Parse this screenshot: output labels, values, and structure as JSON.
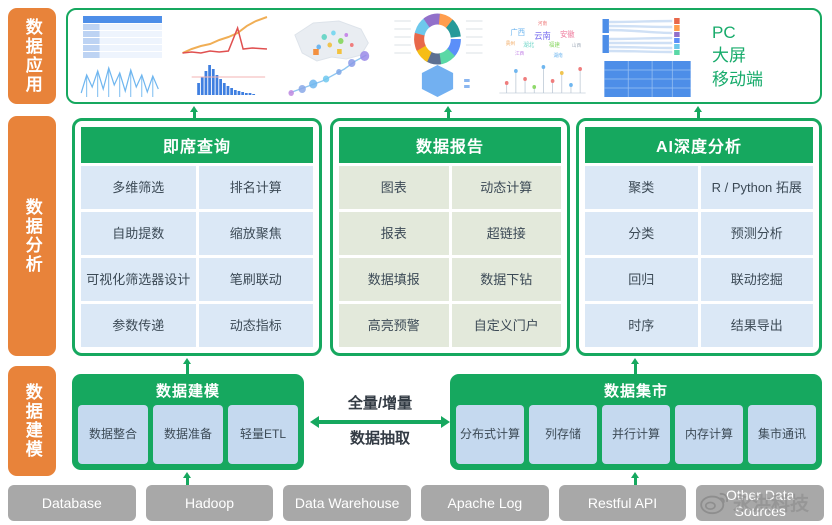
{
  "rails": [
    {
      "id": "data-application",
      "label": "数据应用"
    },
    {
      "id": "data-analysis",
      "label": "数据分析"
    },
    {
      "id": "data-modeling",
      "label": "数据建模"
    }
  ],
  "application_band": {
    "devices": [
      "PC",
      "大屏",
      "移动端"
    ],
    "thumbnails": [
      "data-table-thumbnail",
      "line-chart-thumbnail",
      "map-chart-thumbnail",
      "donut-chart-thumbnail",
      "word-cloud-thumbnail",
      "sankey-chart-thumbnail"
    ]
  },
  "analysis_panels": [
    {
      "title": "即席查询",
      "cell_style": "blue",
      "cells": [
        "多维筛选",
        "排名计算",
        "自助提数",
        "缩放聚焦",
        "可视化筛选器设计",
        "笔刷联动",
        "参数传递",
        "动态指标"
      ]
    },
    {
      "title": "数据报告",
      "cell_style": "olive",
      "cells": [
        "图表",
        "动态计算",
        "报表",
        "超链接",
        "数据填报",
        "数据下钻",
        "高亮预警",
        "自定义门户"
      ]
    },
    {
      "title": "AI深度分析",
      "cell_style": "blue",
      "cells": [
        "聚类",
        "R / Python 拓展",
        "分类",
        "预测分析",
        "回归",
        "联动挖掘",
        "时序",
        "结果导出"
      ]
    }
  ],
  "modeling": {
    "model_box": {
      "title": "数据建模",
      "cells": [
        "数据整合",
        "数据准备",
        "轻量ETL"
      ]
    },
    "extract": {
      "top_label": "全量/增量",
      "bottom_label": "数据抽取"
    },
    "mart_box": {
      "title": "数据集市",
      "cells": [
        "分布式计算",
        "列存储",
        "并行计算",
        "内存计算",
        "集市通讯"
      ]
    }
  },
  "sources": [
    "Database",
    "Hadoop",
    "Data Warehouse",
    "Apache Log",
    "Restful API",
    "Other Data Sources"
  ],
  "watermark": {
    "text": "永洪科技",
    "logo": "weibo-logo"
  },
  "colors": {
    "accent_green": "#16a85f",
    "rail_orange": "#e8833a",
    "cell_blue": "#dbe8f6",
    "cell_olive": "#e3e9db",
    "mart_cell_blue": "#c5d9ef",
    "source_gray": "#a8a8a8",
    "device_text_green": "#17ab6b"
  }
}
